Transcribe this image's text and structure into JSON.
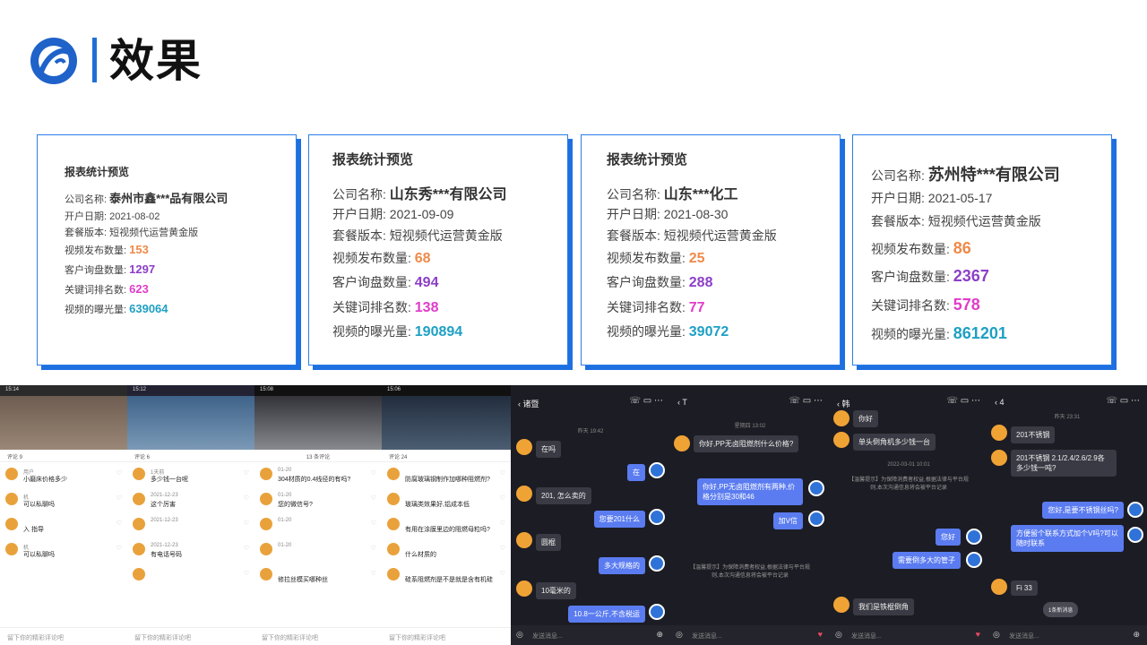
{
  "page": {
    "title": "效果"
  },
  "colors": {
    "accent": "#1f6fd6",
    "orange": "#ef8a4a",
    "purple": "#8c3fc7",
    "magenta": "#e03cc9",
    "teal": "#1ea0c4"
  },
  "cards": [
    {
      "heading": "报表统计预览",
      "company_label": "公司名称:",
      "company": "泰州市鑫***品有限公司",
      "open_label": "开户日期:",
      "open_date": "2021-08-02",
      "plan_label": "套餐版本:",
      "plan": "短视频代运营黄金版",
      "videos_label": "视频发布数量:",
      "videos": "153",
      "inquiries_label": "客户询盘数量:",
      "inquiries": "1297",
      "keywords_label": "关键词排名数:",
      "keywords": "623",
      "exposure_label": "视频的曝光量:",
      "exposure": "639064"
    },
    {
      "heading": "报表统计预览",
      "company_label": "公司名称:",
      "company": "山东秀***有限公司",
      "open_label": "开户日期:",
      "open_date": "2021-09-09",
      "plan_label": "套餐版本:",
      "plan": "短视频代运营黄金版",
      "videos_label": "视频发布数量:",
      "videos": "68",
      "inquiries_label": "客户询盘数量:",
      "inquiries": "494",
      "keywords_label": "关键词排名数:",
      "keywords": "138",
      "exposure_label": "视频的曝光量:",
      "exposure": "190894"
    },
    {
      "heading": "报表统计预览",
      "company_label": "公司名称:",
      "company": "山东***化工",
      "open_label": "开户日期:",
      "open_date": "2021-08-30",
      "plan_label": "套餐版本:",
      "plan": "短视频代运营黄金版",
      "videos_label": "视频发布数量:",
      "videos": "25",
      "inquiries_label": "客户询盘数量:",
      "inquiries": "288",
      "keywords_label": "关键词排名数:",
      "keywords": "77",
      "exposure_label": "视频的曝光量:",
      "exposure": "39072"
    },
    {
      "heading": "",
      "company_label": "公司名称:",
      "company": "苏州特***有限公司",
      "open_label": "开户日期:",
      "open_date": "2021-05-17",
      "plan_label": "套餐版本:",
      "plan": "短视频代运营黄金版",
      "videos_label": "视频发布数量:",
      "videos": "86",
      "inquiries_label": "客户询盘数量:",
      "inquiries": "2367",
      "keywords_label": "关键词排名数:",
      "keywords": "578",
      "exposure_label": "视频的曝光量:",
      "exposure": "861201"
    }
  ],
  "comment_phones": [
    {
      "time": "15:14",
      "header": "评论 9",
      "comments": [
        {
          "meta": "用户",
          "text": "小磨床价格多少"
        },
        {
          "meta": "机",
          "text": "可以私聊吗"
        },
        {
          "meta": "",
          "text": "入 指导"
        },
        {
          "meta": "机",
          "text": "可以私聊吗"
        }
      ],
      "input": "留下你的精彩评论吧"
    },
    {
      "time": "15:12",
      "header": "评论 6",
      "comments": [
        {
          "meta": "1天前",
          "text": "多少钱一台呢"
        },
        {
          "meta": "2021-12-23",
          "text": "这个厉害"
        },
        {
          "meta": "2021-12-23",
          "text": ""
        },
        {
          "meta": "2021-12-23",
          "text": "有电话号码"
        },
        {
          "meta": "",
          "text": ""
        }
      ],
      "input": "留下你的精彩评论吧"
    },
    {
      "time": "15:08",
      "header": "13 条评论",
      "comments": [
        {
          "meta": "01-20",
          "text": "304材质的0.4线径的有吗?"
        },
        {
          "meta": "01-20",
          "text": "您的微信号?"
        },
        {
          "meta": "01-20",
          "text": ""
        },
        {
          "meta": "01-20",
          "text": ""
        },
        {
          "meta": "",
          "text": "修拉丝模买哪种丝"
        }
      ],
      "input": "留下你的精彩评论吧"
    },
    {
      "time": "15:06",
      "header": "评论 24",
      "comments": [
        {
          "meta": "",
          "text": "防腐玻璃钢制作加哪种阻燃剂?"
        },
        {
          "meta": "",
          "text": "玻璃类效果好,铝成本低"
        },
        {
          "meta": "",
          "text": "有用在涂膜里边的阻燃母粒吗?"
        },
        {
          "meta": "",
          "text": "什么材质的"
        },
        {
          "meta": "",
          "text": "硅系阻燃剂是不是就是含有机硅"
        }
      ],
      "input": "留下你的精彩评论吧"
    }
  ],
  "chat_phones": [
    {
      "title": "诸暨",
      "date": "昨天 19:42",
      "messages": [
        {
          "dir": "in",
          "text": "在吗"
        },
        {
          "dir": "out",
          "text": "在"
        },
        {
          "dir": "in",
          "text": "201, 怎么卖的"
        },
        {
          "dir": "out",
          "text": "您要201什么"
        },
        {
          "dir": "in",
          "text": "圆棍"
        },
        {
          "dir": "out",
          "text": "多大规格的"
        },
        {
          "dir": "in",
          "text": "10毫米的"
        },
        {
          "dir": "out",
          "text": "10.8一公斤,不含税运"
        }
      ],
      "input": "发送消息..."
    },
    {
      "title": "T",
      "date": "星期四 13:02",
      "messages": [
        {
          "dir": "in",
          "text": "你好,PP无卤阻燃剂什么价格?"
        },
        {
          "dir": "out",
          "text": "你好,PP无卤阻燃剂有两种,价格分别是30和46"
        },
        {
          "dir": "out",
          "text": "加V信"
        }
      ],
      "sys": "【温馨提示】为保障消费者权益,根据法律与平台规则,本次沟通信息将会被平台记录",
      "input": "发送消息..."
    },
    {
      "title": "韩",
      "date": "2022-03-01 10:01",
      "messages": [
        {
          "dir": "in",
          "text": "你好"
        },
        {
          "dir": "in",
          "text": "单头倒角机多少钱一台"
        },
        {
          "dir": "out",
          "text": "您好"
        },
        {
          "dir": "out",
          "text": "需要倒多大的管子"
        },
        {
          "dir": "in",
          "text": "我们是铁棍倒角"
        }
      ],
      "sys": "【温馨提示】为保障消费者权益,根据法律与平台规则,本次沟通信息将会被平台记录",
      "input": "发送消息..."
    },
    {
      "title": "4",
      "date": "昨天 23:31",
      "messages": [
        {
          "dir": "in",
          "text": "201不锈钢"
        },
        {
          "dir": "in",
          "text": "201不锈钢 2.1/2.4/2.6/2.9各多少钱一吨?"
        },
        {
          "dir": "out",
          "text": "您好,是要不锈钢丝吗?"
        },
        {
          "dir": "out",
          "text": "方便留个联系方式加个V吗?可以随时联系"
        },
        {
          "dir": "in",
          "text": "Fi        33"
        }
      ],
      "badge": "1条新消息",
      "input": "发送消息..."
    }
  ]
}
